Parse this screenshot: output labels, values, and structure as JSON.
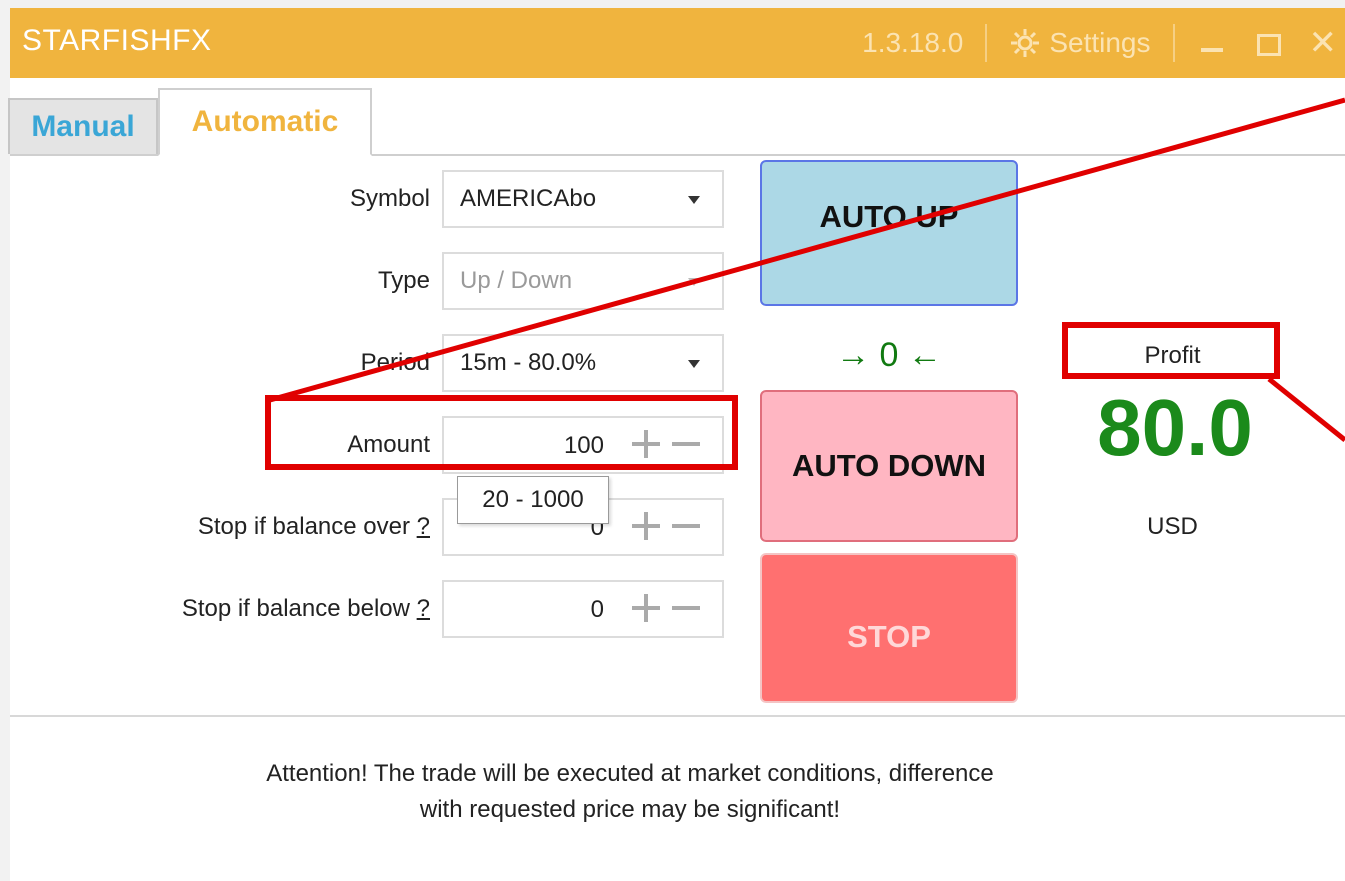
{
  "app": {
    "title": "STARFISHFX",
    "version": "1.3.18.0",
    "settings_label": "Settings",
    "close_glyph": "✕"
  },
  "tabs": [
    {
      "label": "Manual",
      "active": false
    },
    {
      "label": "Automatic",
      "active": true
    }
  ],
  "form": {
    "symbol": {
      "label": "Symbol",
      "value": "AMERICAbo"
    },
    "type": {
      "label": "Type",
      "value": "Up / Down",
      "disabled": true
    },
    "period": {
      "label": "Period",
      "value": "15m - 80.0%"
    },
    "amount": {
      "label": "Amount",
      "value": "100",
      "range_tooltip": "20 - 1000"
    },
    "stop_over": {
      "label": "Stop if balance over",
      "help": "?",
      "value": "0"
    },
    "stop_below": {
      "label": "Stop if balance below",
      "help": "?",
      "value": "0"
    }
  },
  "actions": {
    "auto_up": "AUTO UP",
    "auto_down": "AUTO DOWN",
    "stop": "STOP",
    "counter": "→ 0 ←"
  },
  "profit": {
    "label": "Profit",
    "value": "80.0",
    "currency": "USD"
  },
  "notice": {
    "line1": "Attention! The trade will be executed at market conditions, difference",
    "line2": "with requested price may be significant!"
  },
  "colors": {
    "titlebar": "#f0b43e",
    "accent_blue": "#3aa6d6",
    "accent_orange": "#f0b43e",
    "profit_green": "#1b8a1b",
    "annotation_red": "#e00000"
  }
}
